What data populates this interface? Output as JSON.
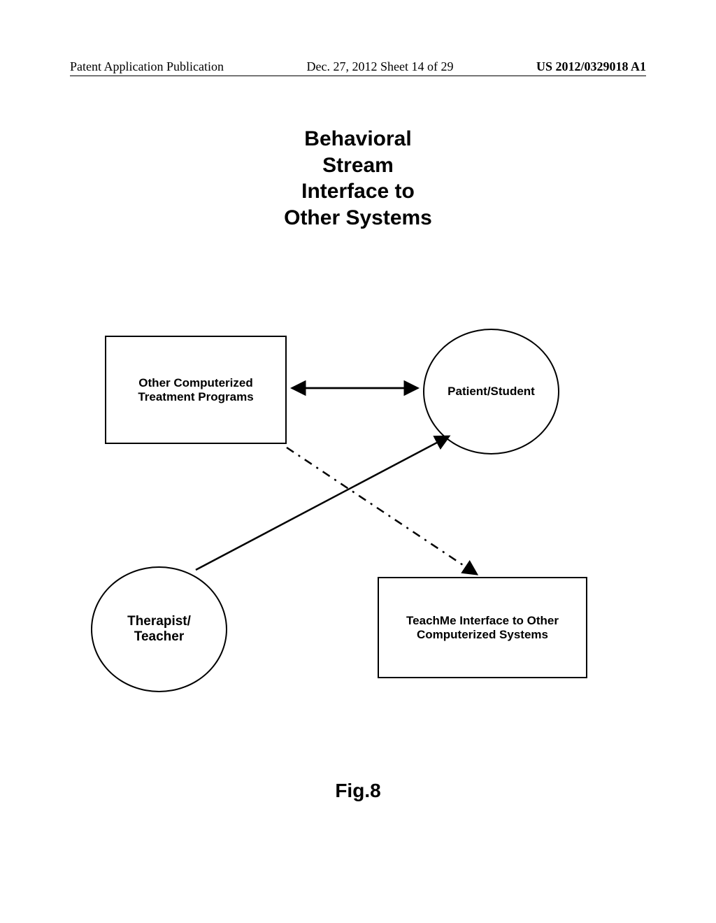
{
  "header": {
    "left": "Patent Application Publication",
    "center": "Dec. 27, 2012  Sheet 14 of 29",
    "right": "US 2012/0329018 A1"
  },
  "title": {
    "line1": "Behavioral",
    "line2": "Stream",
    "line3": "Interface to",
    "line4": "Other Systems"
  },
  "diagram": {
    "box1_line1": "Other Computerized",
    "box1_line2": "Treatment Programs",
    "box2_line1": "TeachMe Interface to Other",
    "box2_line2": "Computerized Systems",
    "circle1": "Patient/Student",
    "circle2_line1": "Therapist/",
    "circle2_line2": "Teacher"
  },
  "figure_label": "Fig.8"
}
